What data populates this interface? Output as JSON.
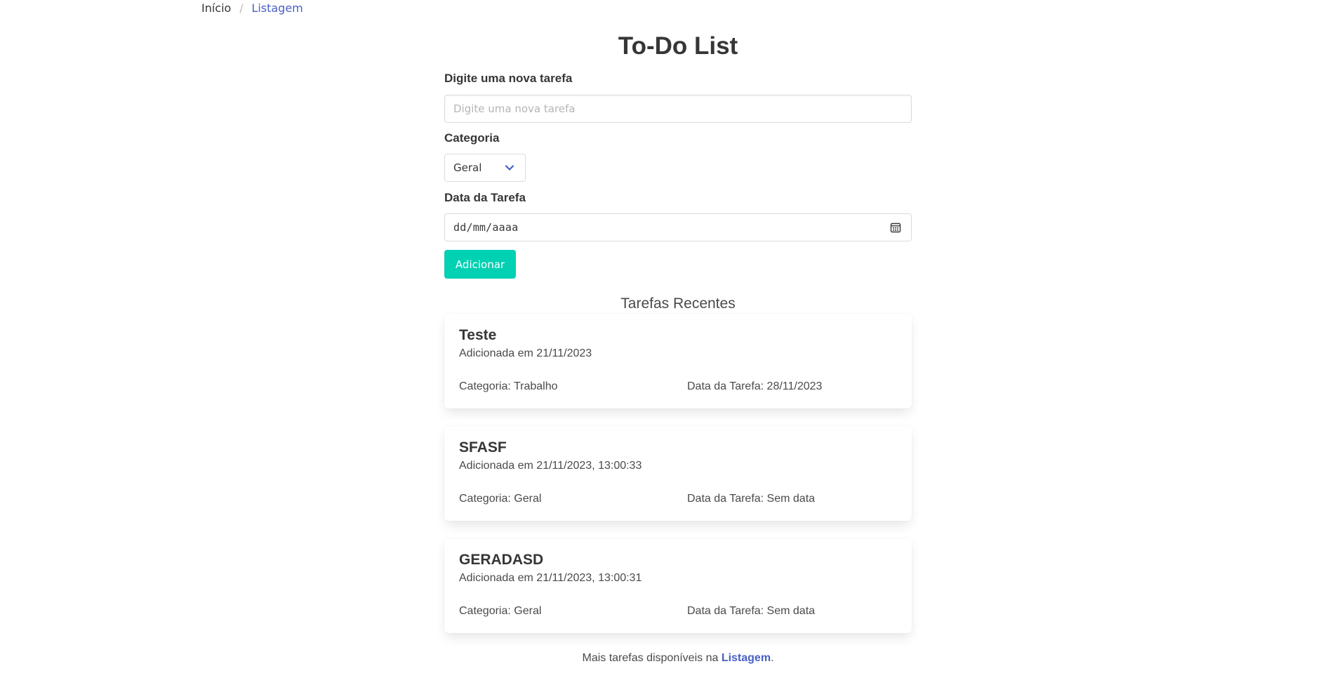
{
  "breadcrumb": {
    "home": "Início",
    "separator": "/",
    "current": "Listagem"
  },
  "title": "To-Do List",
  "form": {
    "task_label": "Digite uma nova tarefa",
    "task_placeholder": "Digite uma nova tarefa",
    "task_value": "",
    "category_label": "Categoria",
    "category_selected": "Geral",
    "date_label": "Data da Tarefa",
    "date_placeholder": "dd/mm/aaaa",
    "add_button": "Adicionar"
  },
  "recent": {
    "heading": "Tarefas Recentes",
    "tasks": [
      {
        "title": "Teste",
        "added": "Adicionada em 21/11/2023",
        "category": "Categoria: Trabalho",
        "date": "Data da Tarefa: 28/11/2023"
      },
      {
        "title": "SFASF",
        "added": "Adicionada em 21/11/2023, 13:00:33",
        "category": "Categoria: Geral",
        "date": "Data da Tarefa: Sem data"
      },
      {
        "title": "GERADASD",
        "added": "Adicionada em 21/11/2023, 13:00:31",
        "category": "Categoria: Geral",
        "date": "Data da Tarefa: Sem data"
      }
    ]
  },
  "footer": {
    "text_before": "Mais tarefas disponíveis na ",
    "link": "Listagem",
    "text_after": "."
  },
  "colors": {
    "primary_button": "#00d1b2",
    "link": "#485fc7",
    "text": "#363636"
  },
  "icons": {
    "select": "chevron-down-icon",
    "date": "calendar-icon"
  }
}
